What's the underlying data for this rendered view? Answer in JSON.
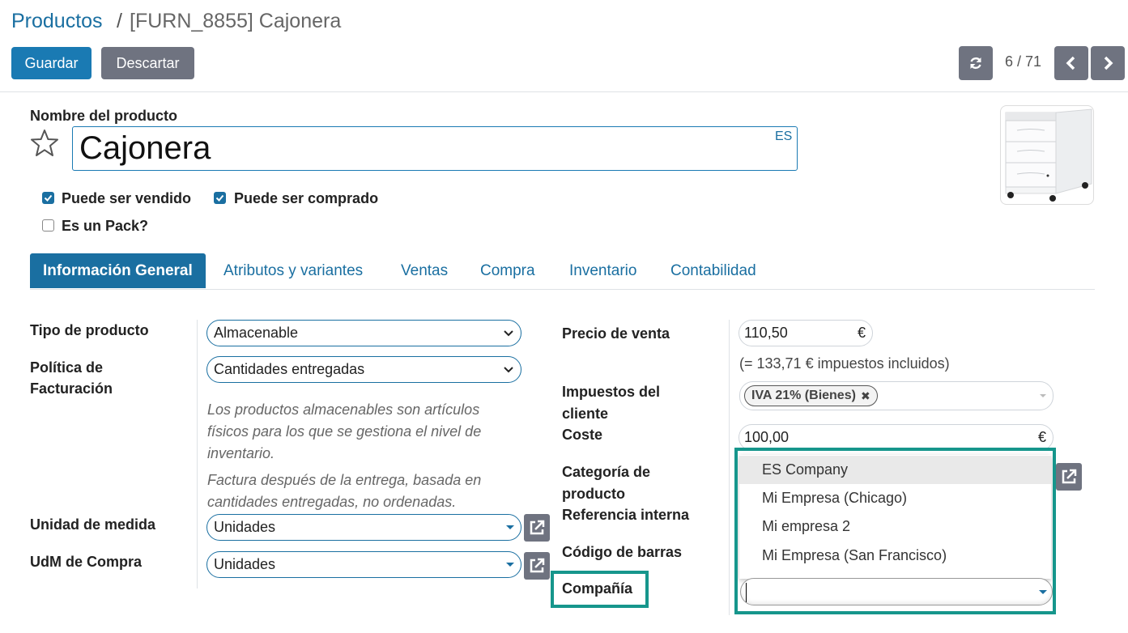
{
  "breadcrumb": {
    "root": "Productos",
    "separator": "/",
    "current": "[FURN_8855] Cajonera"
  },
  "toolbar": {
    "save_label": "Guardar",
    "discard_label": "Descartar"
  },
  "pager": {
    "text": "6 / 71",
    "refresh_icon": "refresh-icon",
    "prev_icon": "chevron-left-icon",
    "next_icon": "chevron-right-icon"
  },
  "product": {
    "name_label": "Nombre del producto",
    "name": "Cajonera",
    "lang": "ES",
    "favorite_icon": "star-icon",
    "can_be_sold_label": "Puede ser vendido",
    "can_be_sold": true,
    "can_be_purchased_label": "Puede ser comprado",
    "can_be_purchased": true,
    "is_pack_label": "Es un Pack?",
    "is_pack": false
  },
  "tabs": [
    {
      "label": "Información General",
      "active": true
    },
    {
      "label": "Atributos y variantes",
      "active": false
    },
    {
      "label": "Ventas",
      "active": false
    },
    {
      "label": "Compra",
      "active": false
    },
    {
      "label": "Inventario",
      "active": false
    },
    {
      "label": "Contabilidad",
      "active": false
    }
  ],
  "left_fields": {
    "product_type_label": "Tipo de producto",
    "product_type": "Almacenable",
    "invoice_policy_label_1": "Política de",
    "invoice_policy_label_2": "Facturación",
    "invoice_policy": "Cantidades entregadas",
    "help_storable_1": "Los productos almacenables son artículos",
    "help_storable_2": "físicos para los que se gestiona el nivel de",
    "help_storable_3": "inventario.",
    "help_invoice_1": "Factura después de la entrega, basada en",
    "help_invoice_2": "cantidades entregadas, no ordenadas.",
    "uom_label": "Unidad de medida",
    "uom": "Unidades",
    "purchase_uom_label": "UdM de Compra",
    "purchase_uom": "Unidades"
  },
  "right_fields": {
    "sale_price_label": "Precio de venta",
    "sale_price": "110,50",
    "currency": "€",
    "tax_included_text": "(= 133,71 € impuestos incluidos)",
    "customer_taxes_label_1": "Impuestos del",
    "customer_taxes_label_2": "cliente",
    "customer_tax_tag": "IVA 21% (Bienes)",
    "cost_label": "Coste",
    "cost": "100,00",
    "category_label_1": "Categoría de",
    "category_label_2": "producto",
    "internal_ref_label": "Referencia interna",
    "barcode_label": "Código de barras",
    "company_label": "Compañía",
    "company_value": ""
  },
  "company_dropdown": [
    {
      "label": "ES Company",
      "highlighted": true
    },
    {
      "label": "Mi Empresa (Chicago)",
      "highlighted": false
    },
    {
      "label": "Mi empresa 2",
      "highlighted": false
    },
    {
      "label": "Mi Empresa (San Francisco)",
      "highlighted": false
    }
  ],
  "colors": {
    "primary": "#1a6fa1",
    "secondary": "#6f7380",
    "highlight": "#16968c"
  }
}
